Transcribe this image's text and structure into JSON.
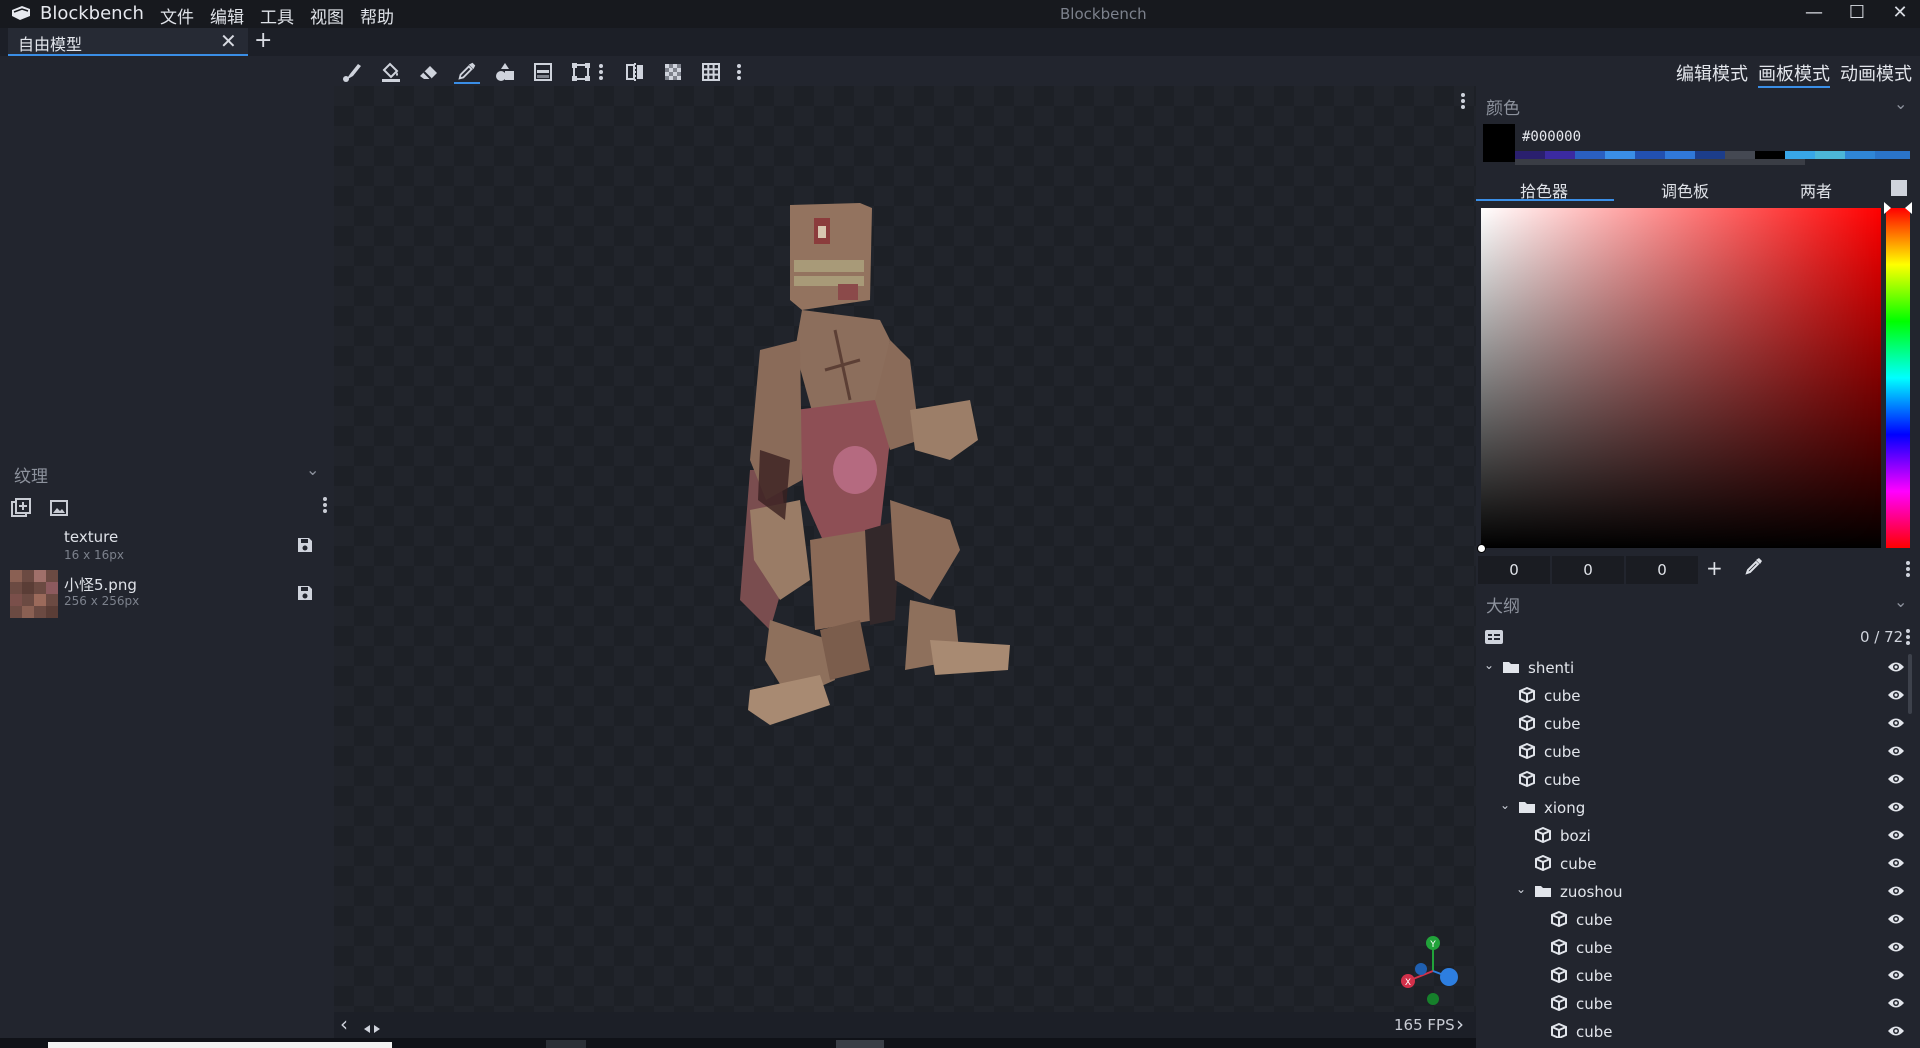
{
  "titlebar": {
    "app_name": "Blockbench",
    "window_title": "Blockbench",
    "menus": [
      "文件",
      "编辑",
      "工具",
      "视图",
      "帮助"
    ],
    "minimize": "—",
    "maximize": "☐",
    "close": "✕"
  },
  "tabs": {
    "active_label": "自由模型",
    "close": "✕",
    "add": "+"
  },
  "textures": {
    "header": "纹理",
    "chevron": "⌄",
    "items": [
      {
        "name": "texture",
        "size": "16 x 16px"
      },
      {
        "name": "小怪5.png",
        "size": "256 x 256px"
      }
    ]
  },
  "toolbar": {
    "icons": [
      "brush-icon",
      "fill-icon",
      "eraser-icon",
      "eyedropper-icon",
      "shapes-icon",
      "gradient-icon",
      "transform-icon",
      "more-icon",
      "mirror-icon",
      "checker-icon",
      "grid-icon",
      "more-icon"
    ]
  },
  "modes": [
    "编辑模式",
    "画板模式",
    "动画模式"
  ],
  "viewport": {
    "fps": "165 FPS",
    "left_arrow": "‹",
    "right_arrow": "›"
  },
  "color": {
    "header": "颜色",
    "hex": "#000000",
    "tabs": [
      "拾色器",
      "调色板",
      "两者"
    ],
    "r": "0",
    "g": "0",
    "b": "0",
    "accent": "#3a8ee6"
  },
  "outline": {
    "header": "大纲",
    "count": "0 / 72",
    "rows": [
      {
        "label": "shenti",
        "type": "folder",
        "open": true
      },
      {
        "label": "cube",
        "type": "cube"
      },
      {
        "label": "cube",
        "type": "cube"
      },
      {
        "label": "cube",
        "type": "cube"
      },
      {
        "label": "cube",
        "type": "cube"
      },
      {
        "label": "xiong",
        "type": "folder",
        "open": true
      },
      {
        "label": "bozi",
        "type": "cube"
      },
      {
        "label": "cube",
        "type": "cube"
      },
      {
        "label": "zuoshou",
        "type": "folder",
        "open": true
      },
      {
        "label": "cube",
        "type": "cube"
      },
      {
        "label": "cube",
        "type": "cube"
      },
      {
        "label": "cube",
        "type": "cube"
      },
      {
        "label": "cube",
        "type": "cube"
      },
      {
        "label": "cube",
        "type": "cube"
      }
    ]
  }
}
